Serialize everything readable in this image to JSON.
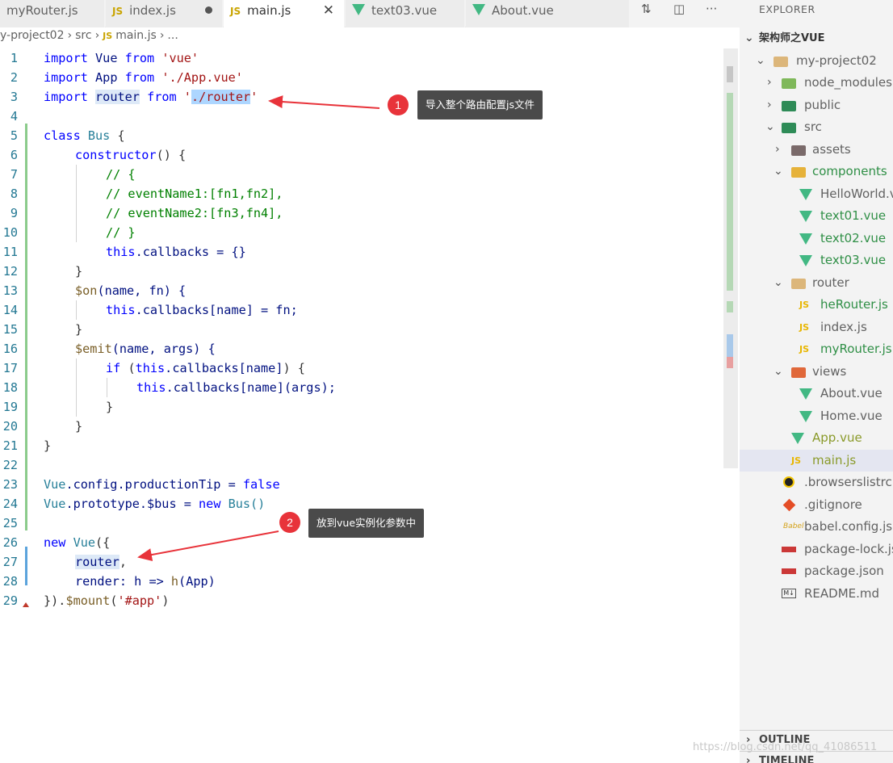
{
  "tabs": [
    {
      "label": "myRouter.js",
      "icon": "js-icon",
      "state": "normal"
    },
    {
      "label": "index.js",
      "icon": "js-icon",
      "state": "modified"
    },
    {
      "label": "main.js",
      "icon": "js-icon",
      "state": "active"
    },
    {
      "label": "text03.vue",
      "icon": "vue-icon",
      "state": "normal"
    },
    {
      "label": "About.vue",
      "icon": "vue-icon",
      "state": "normal"
    }
  ],
  "tab_icon_js": "JS",
  "tab_close": "✕",
  "breadcrumb": [
    "y-project02",
    "›",
    "src",
    "›",
    "JS",
    "main.js",
    "›",
    "..."
  ],
  "code": {
    "lines": [
      {
        "n": "1"
      },
      {
        "n": "2"
      },
      {
        "n": "3"
      },
      {
        "n": "4"
      },
      {
        "n": "5"
      },
      {
        "n": "6"
      },
      {
        "n": "7"
      },
      {
        "n": "8"
      },
      {
        "n": "9"
      },
      {
        "n": "10"
      },
      {
        "n": "11"
      },
      {
        "n": "12"
      },
      {
        "n": "13"
      },
      {
        "n": "14"
      },
      {
        "n": "15"
      },
      {
        "n": "16"
      },
      {
        "n": "17"
      },
      {
        "n": "18"
      },
      {
        "n": "19"
      },
      {
        "n": "20"
      },
      {
        "n": "21"
      },
      {
        "n": "22"
      },
      {
        "n": "23"
      },
      {
        "n": "24"
      },
      {
        "n": "25"
      },
      {
        "n": "26"
      },
      {
        "n": "27"
      },
      {
        "n": "28"
      },
      {
        "n": "29"
      }
    ],
    "t": {
      "import": "import",
      "vue_id": "Vue",
      "from": "from",
      "vue_str": "'vue'",
      "app_id": "App",
      "app_str": "'./App.vue'",
      "router_id": "router",
      "q": "'",
      "router_path": "./router",
      "class": "class",
      "bus": "Bus",
      "brace_open": " {",
      "constructor": "constructor",
      "paren_brace": "() {",
      "c1": "// {",
      "c2": "// eventName1:[fn1,fn2],",
      "c3": "// eventName2:[fn3,fn4],",
      "c4": "// }",
      "this": "this",
      "callbacks_assign": ".callbacks = {}",
      "close_brace": "}",
      "on": "$on",
      "on_params": "(name, fn) {",
      "cb_name": ".callbacks[name] = fn;",
      "emit": "$emit",
      "emit_params": "(name, args) {",
      "if": "if",
      "if_open": " (",
      "cb_index": ".callbacks[name]",
      "if_close": ") {",
      "cb_call": ".callbacks[name](args);",
      "vue_config": "Vue",
      "config_rest": ".config.productionTip = ",
      "false": "false",
      "vue_proto": "Vue",
      "proto_rest": ".prototype.$bus = ",
      "new": "new",
      "bus_call": " Bus()",
      "new_vue_open": "({",
      "router_prop": "router",
      "comma": ",",
      "render": "render",
      "render_rest": ": h => ",
      "h": "h",
      "render_app": "(App)",
      "mount_open": "}).",
      "mount": "$mount",
      "mount_arg_open": "(",
      "mount_arg": "'#app'",
      "mount_close": ")"
    }
  },
  "annotations": [
    {
      "num": "1",
      "text": "导入整个路由配置js文件"
    },
    {
      "num": "2",
      "text": "放到vue实例化参数中"
    }
  ],
  "explorer": {
    "title": "EXPLORER",
    "root": "架构师之VUE",
    "items": [
      {
        "label": "my-project02"
      },
      {
        "label": "node_modules"
      },
      {
        "label": "public"
      },
      {
        "label": "src"
      },
      {
        "label": "assets"
      },
      {
        "label": "components"
      },
      {
        "label": "HelloWorld.vue"
      },
      {
        "label": "text01.vue"
      },
      {
        "label": "text02.vue"
      },
      {
        "label": "text03.vue"
      },
      {
        "label": "router"
      },
      {
        "label": "heRouter.js"
      },
      {
        "label": "index.js"
      },
      {
        "label": "myRouter.js"
      },
      {
        "label": "views"
      },
      {
        "label": "About.vue"
      },
      {
        "label": "Home.vue"
      },
      {
        "label": "App.vue"
      },
      {
        "label": "main.js"
      },
      {
        "label": ".browserslistrc"
      },
      {
        "label": ".gitignore"
      },
      {
        "label": "babel.config.js"
      },
      {
        "label": "package-lock.json"
      },
      {
        "label": "package.json"
      },
      {
        "label": "README.md"
      }
    ],
    "outline": "OUTLINE",
    "timeline": "TIMELINE"
  },
  "watermark": "https://blog.csdn.net/qq_41086511",
  "colors": {
    "keyword": "#0000ff",
    "string": "#a31515",
    "class": "#267f99",
    "comment": "#008000",
    "badge": "#e8333a",
    "vue": "#42b883"
  }
}
